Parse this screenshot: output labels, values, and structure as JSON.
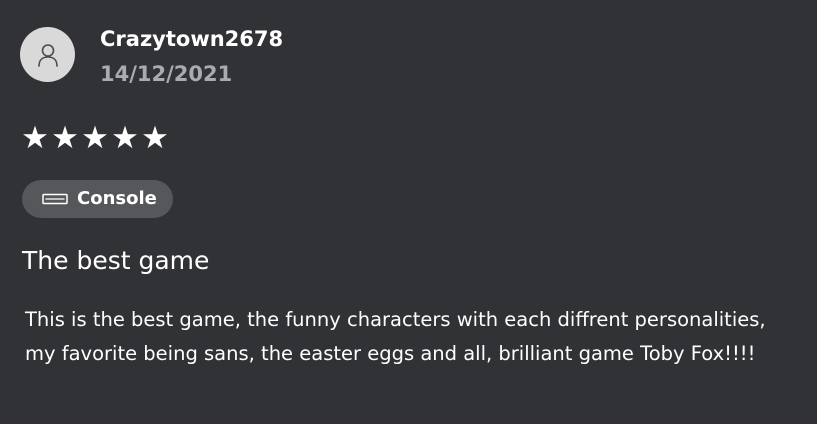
{
  "review": {
    "username": "Crazytown2678",
    "date": "14/12/2021",
    "rating": 5,
    "stars": [
      "★",
      "★",
      "★",
      "★",
      "★"
    ],
    "platform_label": "Console",
    "title": "The best game",
    "body": "This is the best game, the funny characters with each diffrent personalities, my favorite being sans, the easter eggs and all, brilliant game Toby Fox!!!!"
  },
  "icons": {
    "avatar": "user-icon",
    "platform": "console-icon"
  },
  "colors": {
    "background": "#313235",
    "avatar_bg": "#d9d9d9",
    "date_text": "#a9abaf",
    "chip_bg": "#55575b",
    "text": "#ffffff"
  }
}
